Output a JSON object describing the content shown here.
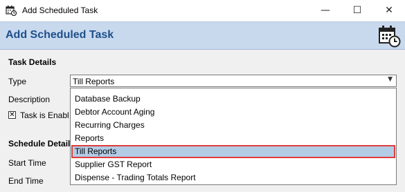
{
  "window": {
    "title": "Add Scheduled Task",
    "controls": {
      "minimize": "—",
      "maximize": "☐",
      "close": "✕"
    }
  },
  "header": {
    "title": "Add Scheduled Task"
  },
  "task_details": {
    "section_label": "Task Details",
    "type_label": "Type",
    "type_value": "Till Reports",
    "description_label": "Description",
    "enabled_label": "Task is Enabl",
    "enabled_checked": "✕"
  },
  "schedule_details": {
    "section_label": "Schedule Details",
    "start_time_label": "Start Time",
    "end_time_label": "End Time"
  },
  "dropdown": {
    "items": [
      "Database Backup",
      "Debtor Account Aging",
      "Recurring Charges",
      "Reports",
      "Till Reports",
      "Supplier GST Report",
      "Dispense - Trading Totals Report"
    ],
    "selected": "Till Reports"
  },
  "colors": {
    "header_bg": "#c8d9ee",
    "header_text": "#1f4f8a",
    "selected_bg": "#b3cce6",
    "highlight_border": "#e03c3c"
  }
}
